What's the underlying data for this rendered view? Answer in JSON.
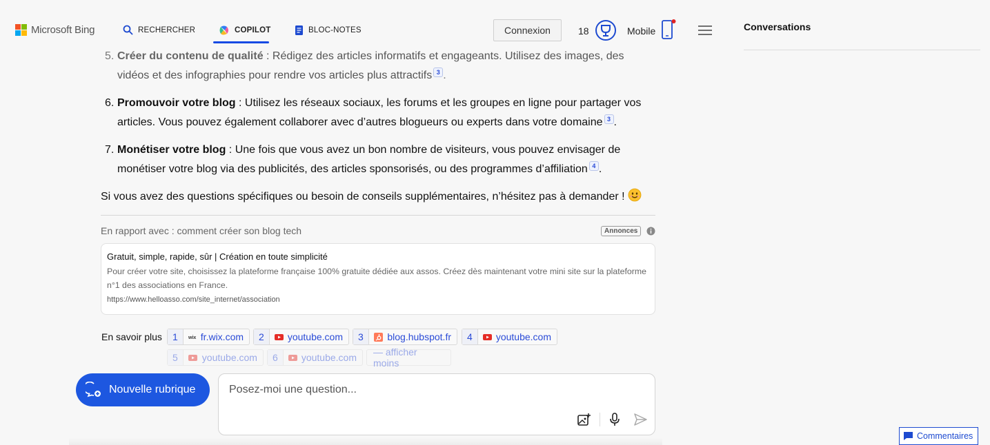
{
  "header": {
    "logo_text": "Microsoft Bing",
    "nav": [
      {
        "label": "RECHERCHER",
        "icon": "search-icon"
      },
      {
        "label": "COPILOT",
        "icon": "copilot-icon",
        "active": true
      },
      {
        "label": "BLOC-NOTES",
        "icon": "notebook-icon"
      }
    ],
    "connexion_label": "Connexion",
    "points": "18",
    "mobile_label": "Mobile"
  },
  "sidebar": {
    "title": "Conversations"
  },
  "answer": {
    "steps": [
      {
        "num": "5.",
        "title": "Créer du contenu de qualité",
        "text_a": " : Rédigez des articles informatifs et engageants. Utilisez des images, des vidéos et des infographies pour rendre vos articles plus attractifs",
        "cite": "3",
        "end": "."
      },
      {
        "num": "6.",
        "title": "Promouvoir votre blog",
        "text_a": " : Utilisez les réseaux sociaux, les forums et les groupes en ligne pour partager vos articles. Vous pouvez également collaborer avec d’autres blogueurs ou experts dans votre domaine",
        "cite": "3",
        "end": "."
      },
      {
        "num": "7.",
        "title": "Monétiser votre blog",
        "text_a": " : Une fois que vous avez un bon nombre de visiteurs, vous pouvez envisager de monétiser votre blog via des publicités, des articles sponsorisés, ou des programmes d’affiliation",
        "cite": "4",
        "end": "."
      }
    ],
    "closing": "Si vous avez des questions spécifiques ou besoin de conseils supplémentaires, n’hésitez pas à demander ! "
  },
  "ads": {
    "related_label": "En rapport avec : comment créer son blog tech",
    "badge": "Annonces",
    "title": "Gratuit, simple, rapide, sûr | Création en toute simplicité",
    "desc": "Pour créer votre site, choisissez la plateforme française 100% gratuite dédiée aux assos. Créez dès maintenant votre mini site sur la plateforme n°1 des associations en France.",
    "url": "https://www.helloasso.com/site_internet/association"
  },
  "sources": {
    "label": "En savoir plus",
    "chips": [
      {
        "n": "1",
        "host": "fr.wix.com",
        "icon": "wix-icon"
      },
      {
        "n": "2",
        "host": "youtube.com",
        "icon": "youtube-icon"
      },
      {
        "n": "3",
        "host": "blog.hubspot.fr",
        "icon": "hubspot-icon"
      },
      {
        "n": "4",
        "host": "youtube.com",
        "icon": "youtube-icon"
      },
      {
        "n": "5",
        "host": "youtube.com",
        "icon": "youtube-icon"
      },
      {
        "n": "6",
        "host": "youtube.com",
        "icon": "youtube-icon"
      }
    ],
    "less_label": "— afficher moins"
  },
  "composer": {
    "new_topic_label": "Nouvelle rubrique",
    "placeholder": "Posez-moi une question..."
  },
  "feedback_label": "Commentaires",
  "colors": {
    "accent": "#174ae4",
    "button_blue": "#1d57e0",
    "link": "#2a4bd7"
  }
}
